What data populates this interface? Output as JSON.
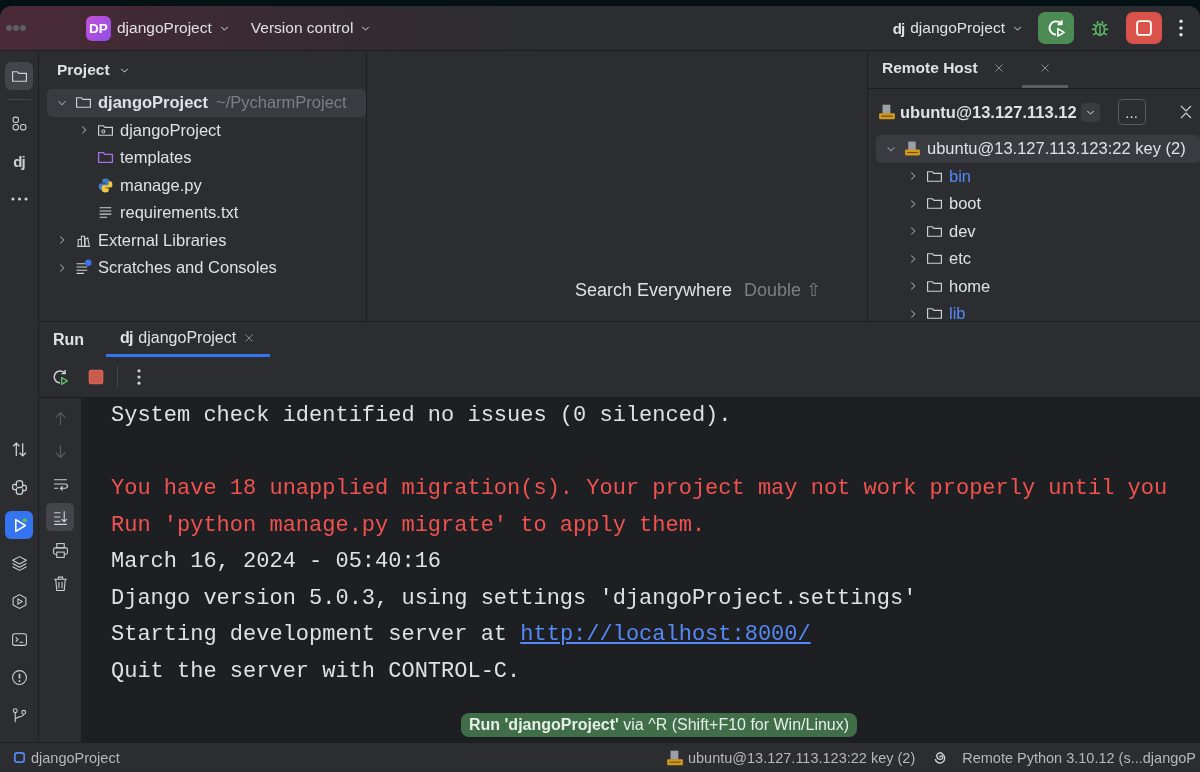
{
  "title_bar": {
    "project_badge": "DP",
    "project": "djangoProject",
    "vcs": "Version control",
    "run_config": {
      "logo": "dj",
      "name": "djangoProject"
    },
    "actions": [
      {
        "kind": "rerun"
      },
      {
        "kind": "debug"
      },
      {
        "kind": "stop"
      },
      {
        "kind": "more"
      }
    ]
  },
  "tool_stripe": {
    "top": [
      {
        "kind": "folder",
        "selected": true
      },
      {
        "kind": "structure",
        "selected": false
      },
      {
        "kind": "django",
        "label": "dj",
        "selected": false
      },
      {
        "kind": "more",
        "selected": false
      }
    ],
    "bottom": [
      {
        "kind": "swap",
        "selected": false
      },
      {
        "kind": "python",
        "selected": false
      },
      {
        "kind": "run",
        "selected": true
      },
      {
        "kind": "layers",
        "selected": false
      },
      {
        "kind": "services",
        "selected": false
      },
      {
        "kind": "terminal",
        "selected": false
      },
      {
        "kind": "problems",
        "selected": false
      },
      {
        "kind": "git",
        "selected": false
      }
    ]
  },
  "project_panel": {
    "title": "Project",
    "tree": [
      {
        "name": "djangoProject",
        "path": "~/PycharmProject",
        "kind": "folder",
        "expanded": true,
        "selected": true,
        "children": [
          {
            "name": "djangoProject",
            "kind": "package",
            "expanded": false,
            "selected": false
          },
          {
            "name": "templates",
            "kind": "templates",
            "selected": false
          },
          {
            "name": "manage.py",
            "kind": "python",
            "selected": false
          },
          {
            "name": "requirements.txt",
            "kind": "text",
            "selected": false
          }
        ]
      },
      {
        "name": "External Libraries",
        "kind": "libraries",
        "expanded": false,
        "selected": false
      },
      {
        "name": "Scratches and Consoles",
        "kind": "scratches",
        "expanded": false,
        "selected": false
      }
    ]
  },
  "editor": {
    "hint": "Search Everywhere",
    "shortcut": "Double ⇧"
  },
  "remote_host": {
    "tabs": [
      {
        "label": "Remote Host",
        "selected": false
      },
      {
        "selected": true
      }
    ],
    "host": "ubuntu@13.127.113.12",
    "more": "...",
    "tree": [
      {
        "name": "ubuntu@13.127.113.123:22 key (2)",
        "kind": "server",
        "expanded": true,
        "selected": true,
        "children": [
          {
            "name": "bin",
            "kind": "folder",
            "expanded": false,
            "selected": false,
            "color": "#548af7"
          },
          {
            "name": "boot",
            "kind": "folder",
            "expanded": false,
            "selected": false,
            "color": "#dfe1e5"
          },
          {
            "name": "dev",
            "kind": "folder",
            "expanded": false,
            "selected": false,
            "color": "#dfe1e5"
          },
          {
            "name": "etc",
            "kind": "folder",
            "expanded": false,
            "selected": false,
            "color": "#dfe1e5"
          },
          {
            "name": "home",
            "kind": "folder",
            "expanded": false,
            "selected": false,
            "color": "#dfe1e5"
          },
          {
            "name": "lib",
            "kind": "folder",
            "expanded": false,
            "selected": false,
            "color": "#548af7"
          }
        ]
      }
    ]
  },
  "run_panel": {
    "title": "Run",
    "tabs": [
      {
        "logo": "dj",
        "label": "djangoProject",
        "selected": true
      }
    ],
    "toolbar": [
      {
        "kind": "rerun"
      },
      {
        "kind": "stop"
      },
      {
        "kind": "more"
      }
    ],
    "side_toolbar": [
      {
        "kind": "up",
        "disabled": true,
        "selected": false
      },
      {
        "kind": "down",
        "disabled": true,
        "selected": false
      },
      {
        "kind": "wrap",
        "disabled": false,
        "selected": false
      },
      {
        "kind": "scroll-end",
        "disabled": false,
        "selected": true
      },
      {
        "kind": "print",
        "disabled": false,
        "selected": false
      },
      {
        "kind": "clear",
        "disabled": false,
        "selected": false
      }
    ],
    "console": [
      {
        "kind": "output",
        "text": "System check identified no issues (0 silenced)."
      },
      {
        "kind": "blank"
      },
      {
        "kind": "error",
        "text": "You have 18 unapplied migration(s). Your project may not work properly until you"
      },
      {
        "kind": "error",
        "text": "Run 'python manage.py migrate' to apply them."
      },
      {
        "kind": "output",
        "text": "March 16, 2024 - 05:40:16"
      },
      {
        "kind": "output",
        "text": "Django version 5.0.3, using settings 'djangoProject.settings'"
      },
      {
        "kind": "output",
        "text": "Starting development server at ",
        "link": "http://localhost:8000/"
      },
      {
        "kind": "output",
        "text": "Quit the server with CONTROL-C."
      }
    ],
    "tooltip": "**Run 'djangoProject'** via ^R (Shift+F10 for Win/Linux)"
  },
  "status_bar": {
    "project": "djangoProject",
    "connection": "ubuntu@13.127.113.123:22 key (2)",
    "interpreter": "Remote Python 3.10.12 (s...djangoP"
  }
}
